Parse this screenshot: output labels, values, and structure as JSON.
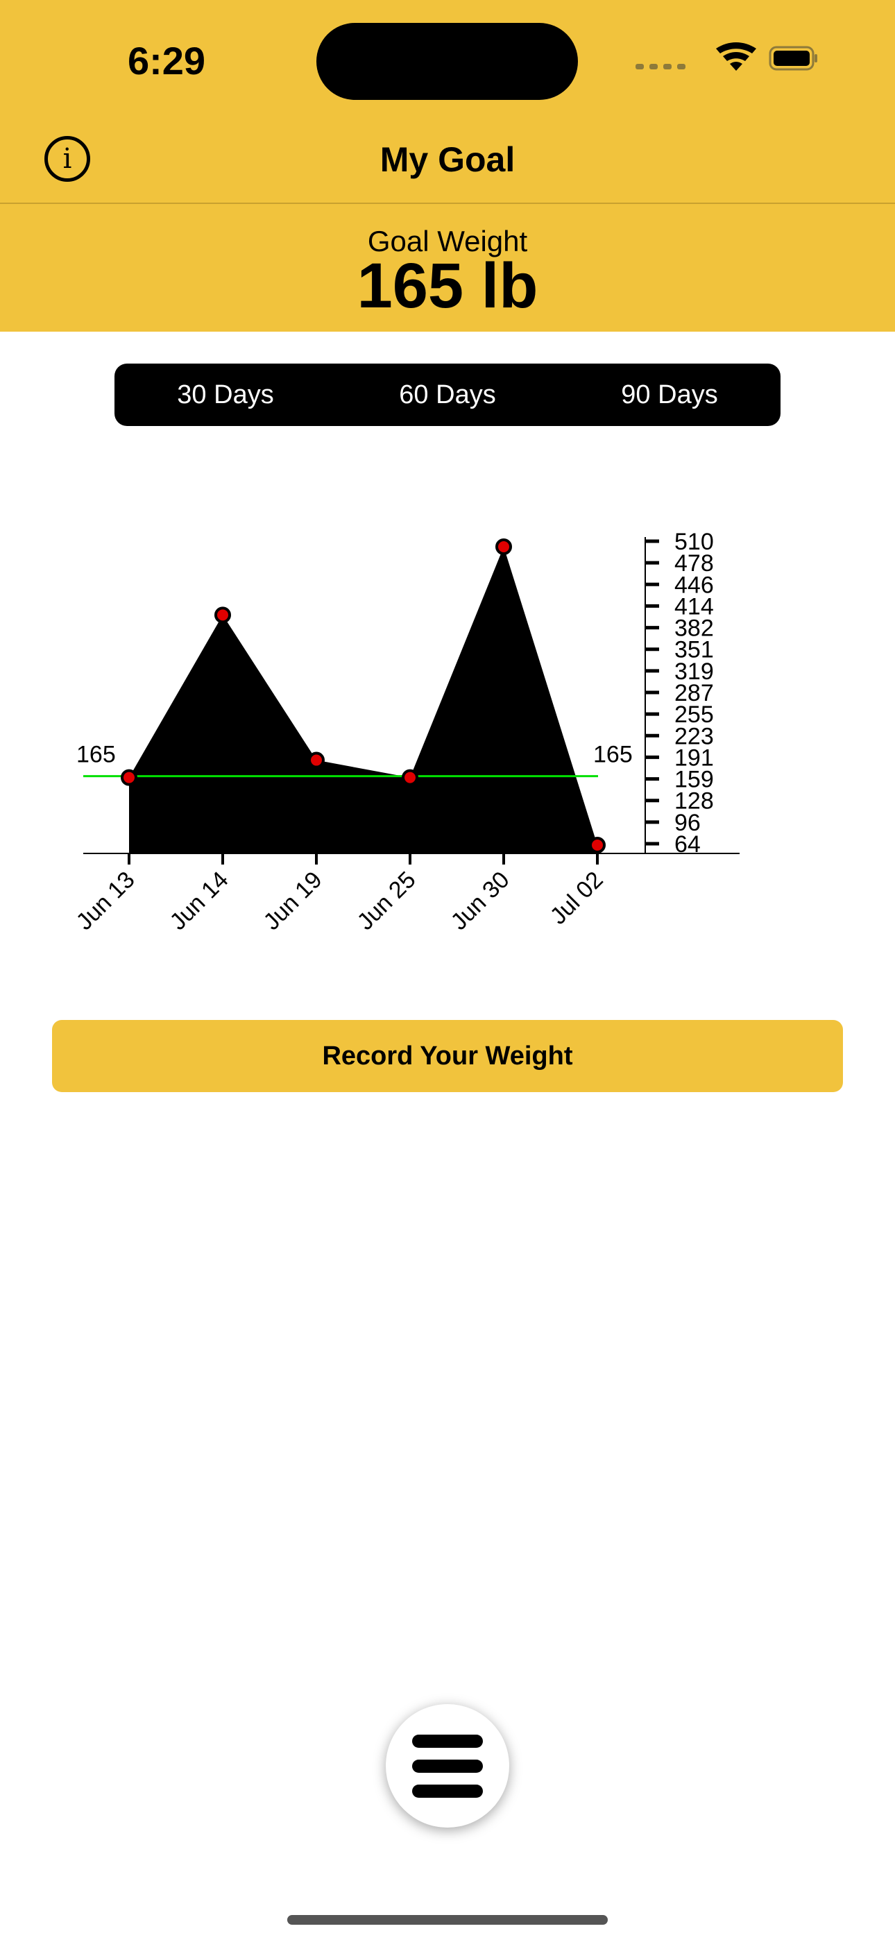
{
  "status_bar": {
    "time": "6:29"
  },
  "nav": {
    "title": "My Goal",
    "info_icon": "info-circle-icon"
  },
  "goal": {
    "label": "Goal Weight",
    "value": "165 lb"
  },
  "range_tabs": [
    {
      "label": "30 Days"
    },
    {
      "label": "60 Days"
    },
    {
      "label": "90 Days"
    }
  ],
  "chart_data": {
    "type": "area",
    "categories": [
      "Jun 13",
      "Jun 14",
      "Jun 19",
      "Jun 25",
      "Jun 30",
      "Jul 02"
    ],
    "values": [
      165,
      408,
      191,
      165,
      510,
      64
    ],
    "goal_line": {
      "value": 165,
      "left_label": "165",
      "right_label": "165",
      "color": "#00E000"
    },
    "y_ticks": [
      "510",
      "478",
      "446",
      "414",
      "382",
      "351",
      "319",
      "287",
      "255",
      "223",
      "191",
      "159",
      "128",
      "96",
      "64"
    ],
    "ylim": [
      64,
      510
    ],
    "point_color": "#E00000",
    "fill_color": "#000000",
    "grid": false
  },
  "record_button": {
    "label": "Record Your Weight"
  },
  "menu_button": {
    "icon": "hamburger-menu-icon"
  },
  "colors": {
    "accent": "#F1C33D"
  }
}
